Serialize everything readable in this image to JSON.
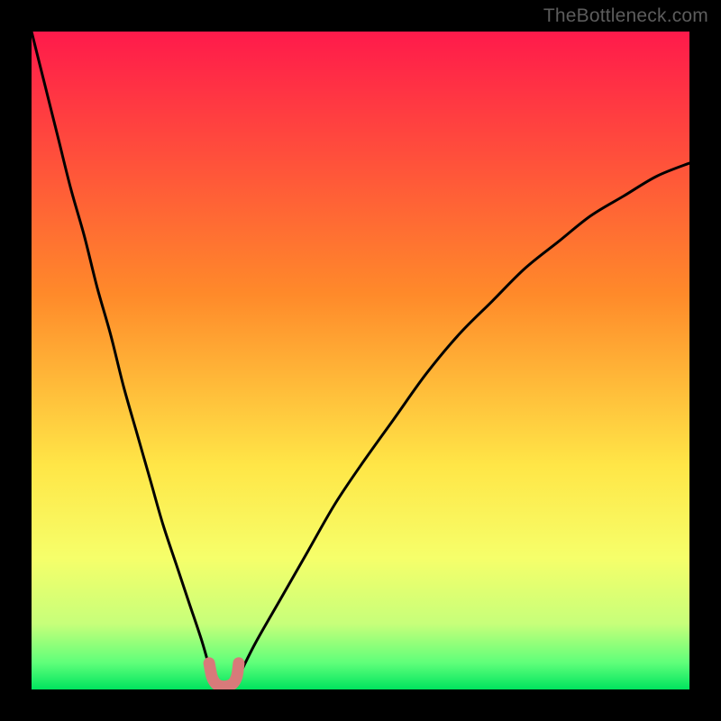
{
  "watermark": {
    "text": "TheBottleneck.com"
  },
  "chart_data": {
    "type": "line",
    "title": "",
    "xlabel": "",
    "ylabel": "",
    "xlim": [
      0,
      100
    ],
    "ylim": [
      0,
      100
    ],
    "grid": false,
    "legend": false,
    "background_gradient": {
      "stops": [
        {
          "offset": 0.0,
          "color": "#ff1a4b"
        },
        {
          "offset": 0.4,
          "color": "#ff8a2a"
        },
        {
          "offset": 0.66,
          "color": "#ffe647"
        },
        {
          "offset": 0.8,
          "color": "#f6ff6a"
        },
        {
          "offset": 0.9,
          "color": "#c7ff7a"
        },
        {
          "offset": 0.96,
          "color": "#5eff7a"
        },
        {
          "offset": 1.0,
          "color": "#00e35e"
        }
      ]
    },
    "series": [
      {
        "name": "left-branch",
        "x": [
          0,
          2,
          4,
          6,
          8,
          10,
          12,
          14,
          16,
          18,
          20,
          22,
          24,
          26,
          27.4
        ],
        "values": [
          100,
          92,
          84,
          76,
          69,
          61,
          54,
          46,
          39,
          32,
          25,
          19,
          13,
          7,
          2
        ],
        "stroke": "#000000"
      },
      {
        "name": "right-branch",
        "x": [
          31.5,
          34,
          38,
          42,
          46,
          50,
          55,
          60,
          65,
          70,
          75,
          80,
          85,
          90,
          95,
          100
        ],
        "values": [
          2,
          7,
          14,
          21,
          28,
          34,
          41,
          48,
          54,
          59,
          64,
          68,
          72,
          75,
          78,
          80
        ],
        "stroke": "#000000"
      },
      {
        "name": "optimum-band",
        "x": [
          27.0,
          27.4,
          28.0,
          28.8,
          29.7,
          30.6,
          31.2,
          31.5
        ],
        "values": [
          4.0,
          2.0,
          0.9,
          0.5,
          0.5,
          0.9,
          2.0,
          4.0
        ],
        "stroke": "#d87a7a"
      }
    ],
    "annotations": []
  },
  "colors": {
    "frame": "#000000",
    "curve": "#000000",
    "band": "#d87a7a",
    "watermark": "#5c5c5c"
  }
}
